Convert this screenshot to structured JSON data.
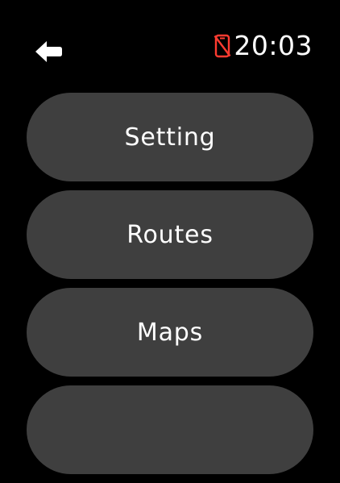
{
  "status_bar": {
    "back_icon": "arrow-left-icon",
    "phone_icon": "phone-disconnected-icon",
    "phone_icon_color": "#ff3b30",
    "time": "20:03"
  },
  "menu": {
    "items": [
      {
        "label": "Setting"
      },
      {
        "label": "Routes"
      },
      {
        "label": "Maps"
      },
      {
        "label": ""
      }
    ]
  },
  "colors": {
    "background": "#000000",
    "button_background": "#3f3f3f",
    "text": "#ffffff"
  }
}
